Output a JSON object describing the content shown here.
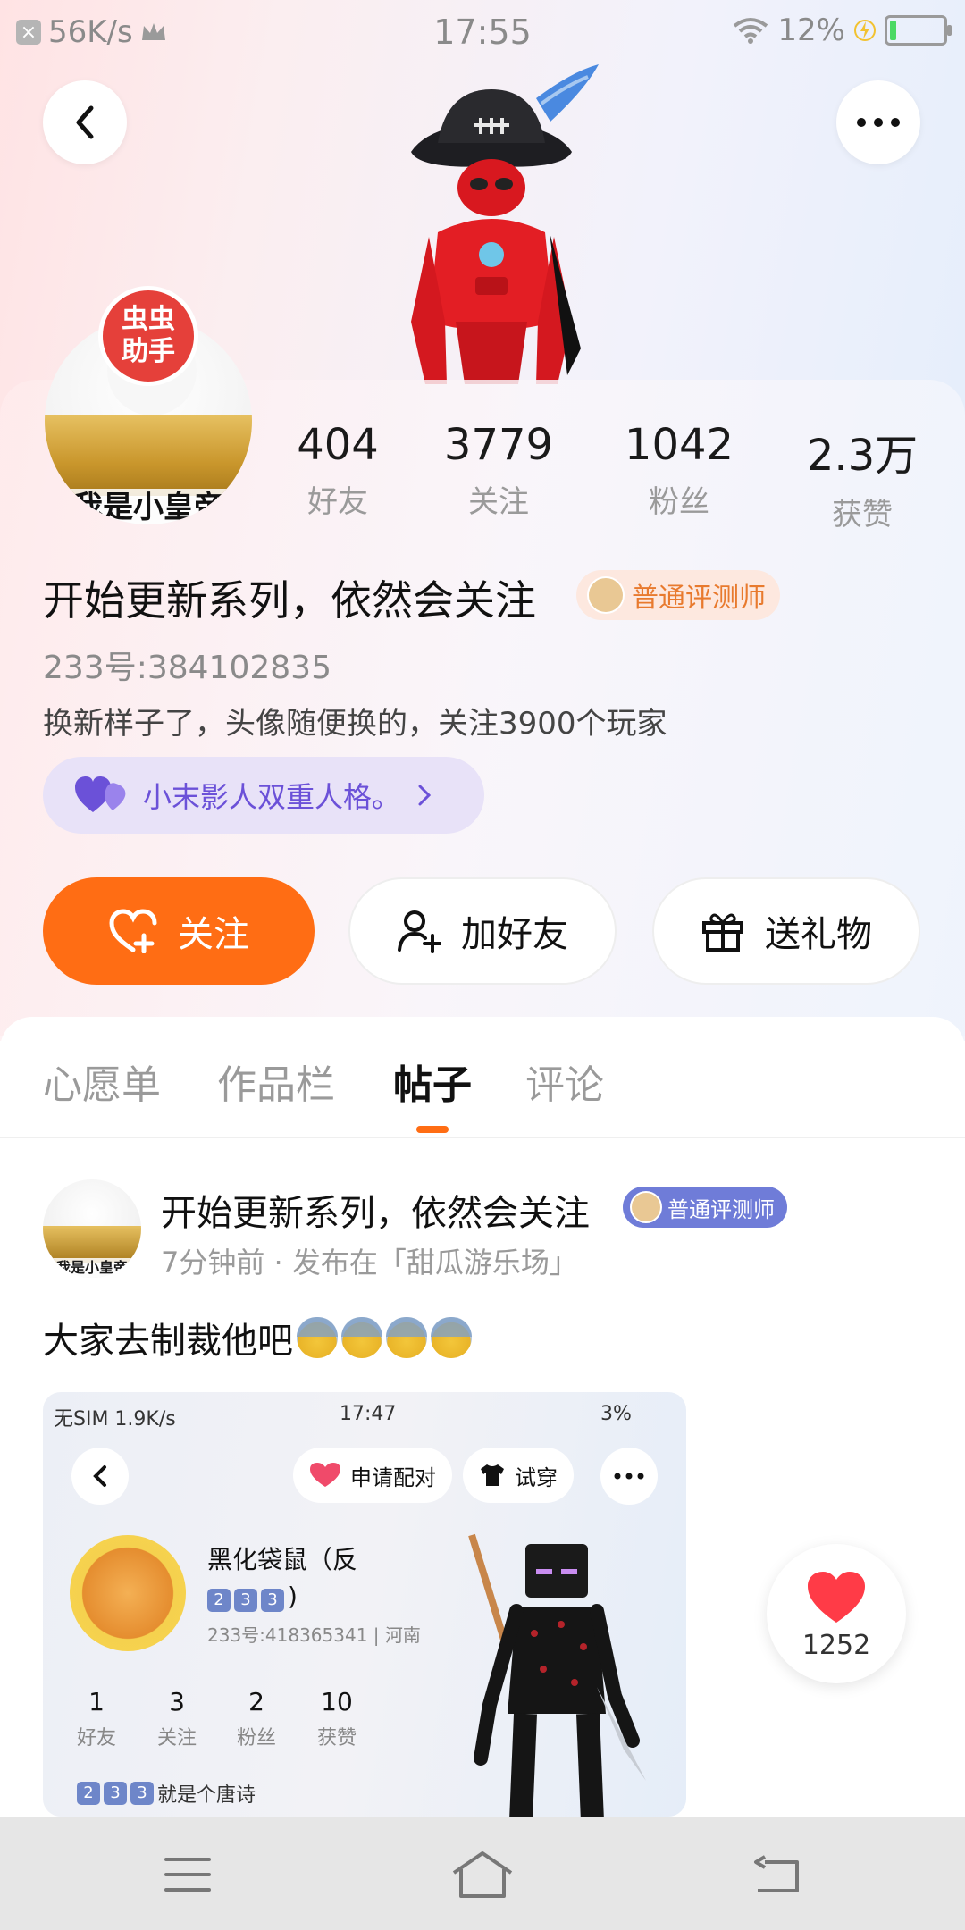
{
  "status_bar": {
    "speed": "56K/s",
    "time": "17:55",
    "battery": "12%",
    "battery_level": 0.12
  },
  "header": {
    "back_icon": "chevron-left-icon",
    "more_icon": "more-dots-icon"
  },
  "profile": {
    "badge": "虫虫\n助手",
    "avatar_caption": "我是小皇帝",
    "stats": [
      {
        "value": "404",
        "label": "好友"
      },
      {
        "value": "3779",
        "label": "关注"
      },
      {
        "value": "1042",
        "label": "粉丝"
      },
      {
        "value": "2.3万",
        "label": "获赞"
      }
    ],
    "name": "开始更新系列，依然会关注",
    "tag": "普通评测师",
    "uid": "233号:384102835",
    "bio": "换新样子了，头像随便换的，关注3900个玩家",
    "relation_pill": "小末影人双重人格。"
  },
  "actions": {
    "follow": "关注",
    "add_friend": "加好友",
    "send_gift": "送礼物"
  },
  "tabs": [
    "心愿单",
    "作品栏",
    "帖子",
    "评论"
  ],
  "active_tab": 2,
  "post": {
    "author": "开始更新系列，依然会关注",
    "author_tag": "普通评测师",
    "avatar_caption": "我是小皇帝",
    "meta": "7分钟前 · 发布在「甜瓜游乐场」",
    "text": "大家去制裁他吧",
    "embedded": {
      "status_left": "无SIM 1.9K/s",
      "status_time": "17:47",
      "status_right": "3%",
      "btn_match": "申请配对",
      "btn_try": "试穿",
      "name_line1": "黑化袋鼠（反",
      "name_line2": "233)",
      "uid": "233号:418365341",
      "location": "河南",
      "stats": [
        {
          "value": "1",
          "label": "好友"
        },
        {
          "value": "3",
          "label": "关注"
        },
        {
          "value": "2",
          "label": "粉丝"
        },
        {
          "value": "10",
          "label": "获赞"
        }
      ],
      "bio_prefix": "233",
      "bio_text": "就是个唐诗"
    },
    "likes": "1252"
  },
  "colors": {
    "accent": "#ff6d14",
    "tag_orange": "#e87a2e",
    "pill_purple": "#6b51d8",
    "like_red": "#ff3b47"
  }
}
